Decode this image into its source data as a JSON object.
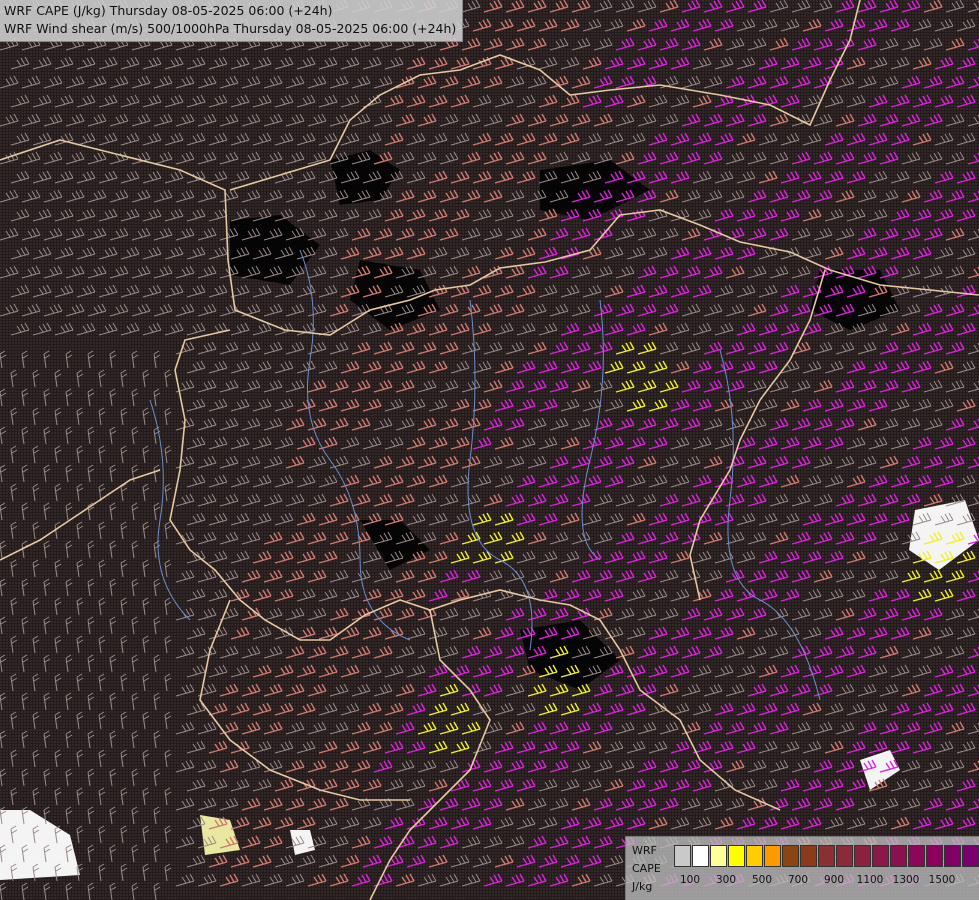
{
  "title": {
    "line1": "WRF CAPE (J/kg) Thursday 08-05-2025 06:00 (+24h)",
    "line2": "WRF Wind shear (m/s) 500/1000hPa Thursday 08-05-2025 06:00 (+24h)"
  },
  "legend": {
    "label_lines": [
      "WRF",
      "CAPE",
      "J/kg"
    ],
    "colors": [
      "#c9c9c9",
      "#ffffff",
      "#ffff99",
      "#ffff00",
      "#ffcc00",
      "#ff9900",
      "#8b4513",
      "#8b3a1a",
      "#8b3030",
      "#8b2a3a",
      "#8b2040",
      "#8b1848",
      "#8b1050",
      "#8b0858",
      "#8b0060",
      "#800068",
      "#780070"
    ],
    "tick_labels": [
      "100",
      "300",
      "500",
      "700",
      "900",
      "1100",
      "1300",
      "1500"
    ]
  },
  "map_colors": {
    "border": "#e6c8a0",
    "river": "#6a8fd0",
    "barb_low": "#9a8a8a",
    "barb_mid": "#d07870",
    "barb_high": "#e020e0",
    "barb_cape": "#f0f020"
  }
}
